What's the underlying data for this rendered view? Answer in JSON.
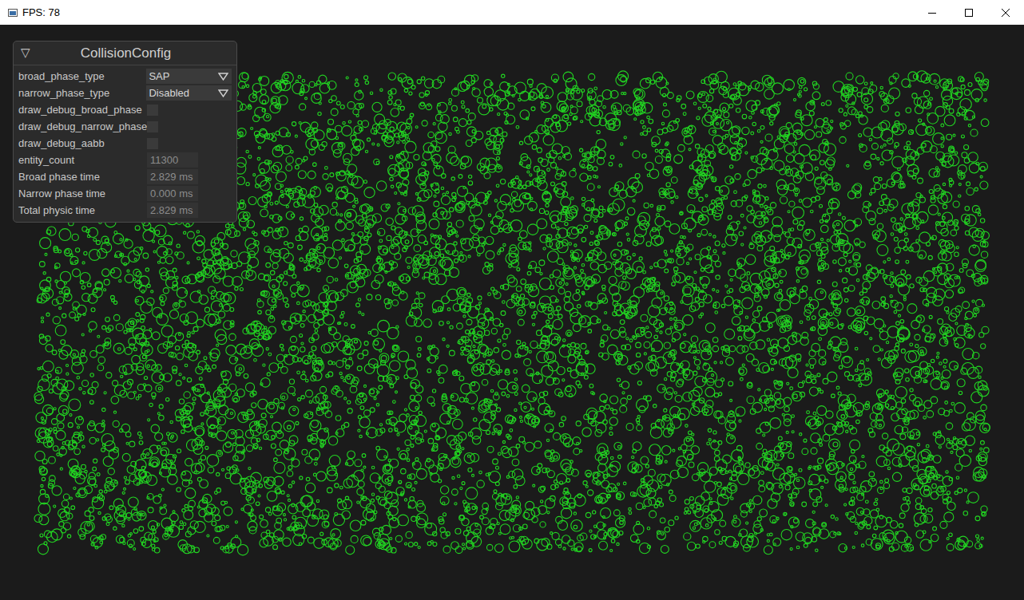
{
  "window": {
    "title": "FPS: 78"
  },
  "panel": {
    "title": "CollisionConfig",
    "collapse_glyph": "▽",
    "expanded": true,
    "rows": [
      {
        "label": "broad_phase_type",
        "kind": "combo",
        "value": "SAP"
      },
      {
        "label": "narrow_phase_type",
        "kind": "combo",
        "value": "Disabled"
      },
      {
        "label": "draw_debug_broad_phase",
        "kind": "checkbox",
        "checked": false
      },
      {
        "label": "draw_debug_narrow_phase",
        "kind": "checkbox",
        "checked": false
      },
      {
        "label": "draw_debug_aabb",
        "kind": "checkbox",
        "checked": false
      },
      {
        "label": "entity_count",
        "kind": "input",
        "value": "11300"
      },
      {
        "label": "Broad phase time",
        "kind": "readonly",
        "value": "2.829 ms"
      },
      {
        "label": "Narrow phase time",
        "kind": "readonly",
        "value": "0.000 ms"
      },
      {
        "label": "Total physic time",
        "kind": "readonly",
        "value": "2.829 ms"
      }
    ]
  }
}
